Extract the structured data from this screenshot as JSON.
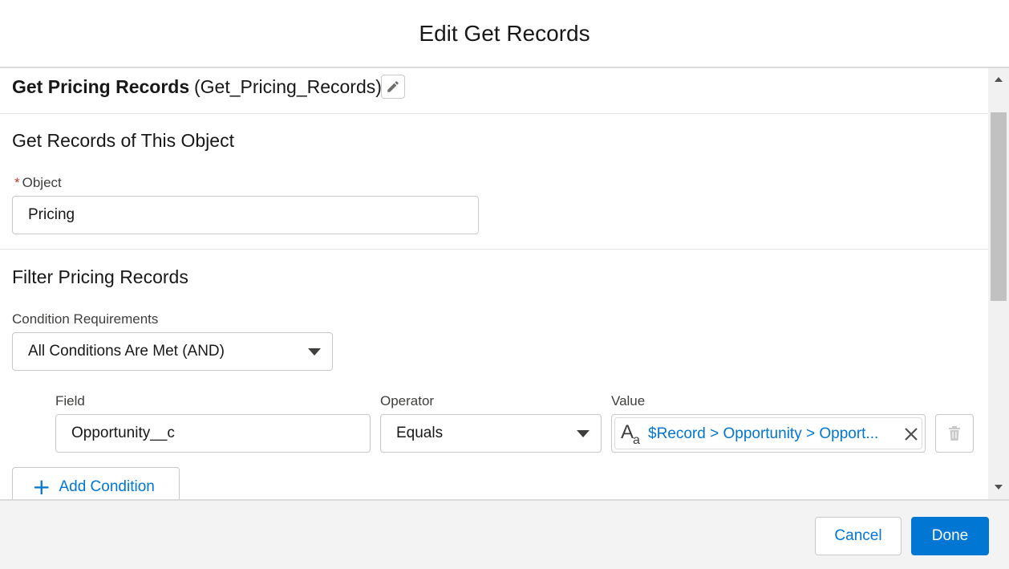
{
  "modal": {
    "title": "Edit Get Records"
  },
  "element": {
    "label": "Get Pricing Records",
    "api_name": "(Get_Pricing_Records)"
  },
  "get_records_section": {
    "title": "Get Records of This Object",
    "object_label": "Object",
    "required_marker": "*",
    "object_value": "Pricing"
  },
  "filter_section": {
    "title": "Filter Pricing Records",
    "condition_requirements_label": "Condition Requirements",
    "condition_requirements_value": "All Conditions Are Met (AND)",
    "columns": {
      "field": "Field",
      "operator": "Operator",
      "value": "Value"
    },
    "condition": {
      "field": "Opportunity__c",
      "operator": "Equals",
      "value": "$Record > Opportunity > Opport..."
    },
    "add_condition_label": "Add Condition"
  },
  "footer": {
    "cancel_label": "Cancel",
    "done_label": "Done"
  },
  "colors": {
    "brand": "#0176d3",
    "required": "#c23934",
    "border": "#c9c9c9"
  },
  "icons": {
    "edit": "pencil-icon",
    "value_type": "text-type-icon",
    "clear": "close-icon",
    "delete": "trash-icon",
    "add": "plus-icon",
    "dropdown": "chevron-down-icon"
  }
}
